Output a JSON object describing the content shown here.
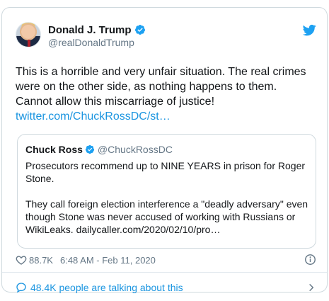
{
  "tweet": {
    "author_name": "Donald J. Trump",
    "author_handle": "@realDonaldTrump",
    "text_line": "This is a horrible and very unfair situation. The real crimes were on the other side, as nothing happens to them. Cannot allow this miscarriage of justice!",
    "link": "twitter.com/ChuckRossDC/st…",
    "likes": "88.7K",
    "timestamp": "6:48 AM - Feb 11, 2020",
    "talking": "48.4K people are talking about this"
  },
  "quote": {
    "author_name": "Chuck Ross",
    "author_handle": "@ChuckRossDC",
    "para1": "Prosecutors recommend up to NINE YEARS in prison for Roger Stone.",
    "para2": "They call foreign election interference a \"deadly adversary\" even though Stone was never accused of working with Russians or WikiLeaks.  dailycaller.com/2020/02/10/pro…"
  },
  "icons": {
    "verified": "verified-badge-icon",
    "bird": "twitter-bird-icon",
    "heart": "heart-icon",
    "info": "info-icon",
    "bubble": "speech-bubble-icon",
    "chevron": "chevron-right-icon"
  },
  "colors": {
    "accent": "#1b95e0",
    "muted": "#657786",
    "border": "#cfd9de",
    "text": "#14171a"
  }
}
